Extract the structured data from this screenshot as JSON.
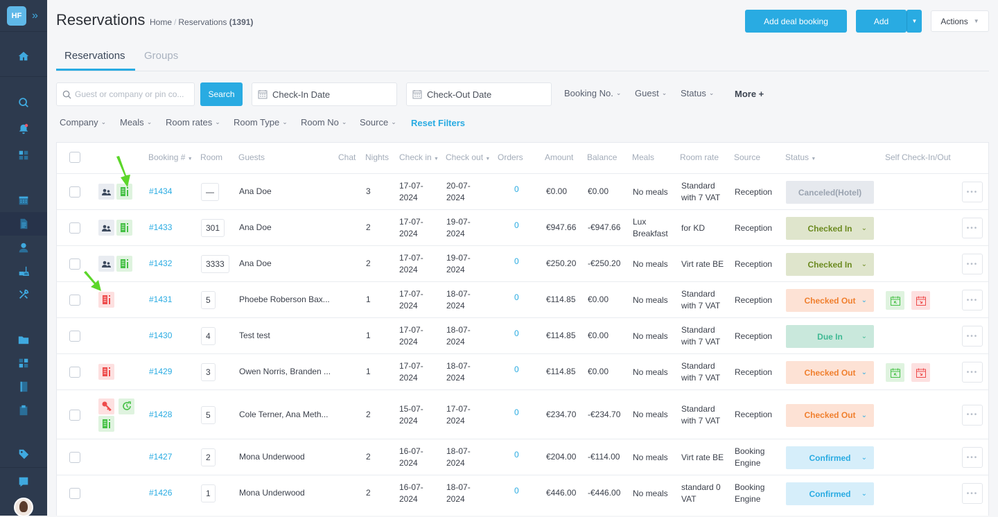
{
  "app": {
    "logo_text": "HF"
  },
  "header": {
    "title": "Reservations",
    "breadcrumb": {
      "home": "Home",
      "current": "Reservations",
      "count": "(1391)"
    },
    "add_deal_label": "Add deal booking",
    "add_label": "Add",
    "actions_label": "Actions"
  },
  "tabs": [
    {
      "label": "Reservations",
      "active": true
    },
    {
      "label": "Groups",
      "active": false
    }
  ],
  "filters": {
    "search_placeholder": "Guest or company or pin co...",
    "search_button": "Search",
    "checkin_placeholder": "Check-In Date",
    "checkout_placeholder": "Check-Out Date",
    "row1": [
      "Booking No.",
      "Guest",
      "Status"
    ],
    "more": "More +",
    "row2": [
      "Company",
      "Meals",
      "Room rates",
      "Room Type",
      "Room No",
      "Source"
    ],
    "reset": "Reset Filters"
  },
  "columns": {
    "booking": "Booking #",
    "room": "Room",
    "guests": "Guests",
    "chat": "Chat",
    "nights": "Nights",
    "checkin": "Check in",
    "checkout": "Check out",
    "orders": "Orders",
    "amount": "Amount",
    "balance": "Balance",
    "meals": "Meals",
    "rate": "Room rate",
    "source": "Source",
    "status": "Status",
    "self": "Self Check-In/Out"
  },
  "rows": [
    {
      "icons": [
        "group-grey",
        "invoice-green"
      ],
      "booking": "#1434",
      "room": "—",
      "guests": "Ana Doe",
      "nights": "3",
      "checkin": [
        "17-07-",
        "2024"
      ],
      "checkout": [
        "20-07-",
        "2024"
      ],
      "orders": "0",
      "amount": "€0.00",
      "balance": "€0.00",
      "meals": [
        "No meals"
      ],
      "rate": [
        "Standard",
        "with 7 VAT"
      ],
      "source": [
        "Reception"
      ],
      "status": "Canceled(Hotel)",
      "status_type": "canceled",
      "self": false
    },
    {
      "icons": [
        "group-grey",
        "invoice-green"
      ],
      "booking": "#1433",
      "room": "301",
      "guests": "Ana Doe",
      "nights": "2",
      "checkin": [
        "17-07-",
        "2024"
      ],
      "checkout": [
        "19-07-",
        "2024"
      ],
      "orders": "0",
      "amount": "€947.66",
      "balance": "-€947.66",
      "meals": [
        "Lux",
        "Breakfast"
      ],
      "rate": [
        "for KD"
      ],
      "source": [
        "Reception"
      ],
      "status": "Checked In",
      "status_type": "checkedin",
      "self": false
    },
    {
      "icons": [
        "group-grey",
        "invoice-green"
      ],
      "booking": "#1432",
      "room": "3333",
      "guests": "Ana Doe",
      "nights": "2",
      "checkin": [
        "17-07-",
        "2024"
      ],
      "checkout": [
        "19-07-",
        "2024"
      ],
      "orders": "0",
      "amount": "€250.20",
      "balance": "-€250.20",
      "meals": [
        "No meals"
      ],
      "rate": [
        "Virt rate BE"
      ],
      "source": [
        "Reception"
      ],
      "status": "Checked In",
      "status_type": "checkedin",
      "self": false
    },
    {
      "icons": [
        "invoice-red"
      ],
      "booking": "#1431",
      "room": "5",
      "guests": "Phoebe Roberson Bax...",
      "nights": "1",
      "checkin": [
        "17-07-",
        "2024"
      ],
      "checkout": [
        "18-07-",
        "2024"
      ],
      "orders": "0",
      "amount": "€114.85",
      "balance": "€0.00",
      "meals": [
        "No meals"
      ],
      "rate": [
        "Standard",
        "with 7 VAT"
      ],
      "source": [
        "Reception"
      ],
      "status": "Checked Out",
      "status_type": "checkedout",
      "self": true
    },
    {
      "icons": [],
      "booking": "#1430",
      "room": "4",
      "guests": "Test test",
      "nights": "1",
      "checkin": [
        "17-07-",
        "2024"
      ],
      "checkout": [
        "18-07-",
        "2024"
      ],
      "orders": "0",
      "amount": "€114.85",
      "balance": "€0.00",
      "meals": [
        "No meals"
      ],
      "rate": [
        "Standard",
        "with 7 VAT"
      ],
      "source": [
        "Reception"
      ],
      "status": "Due In",
      "status_type": "duein",
      "self": false
    },
    {
      "icons": [
        "invoice-red"
      ],
      "booking": "#1429",
      "room": "3",
      "guests": "Owen Norris, Branden ...",
      "nights": "1",
      "checkin": [
        "17-07-",
        "2024"
      ],
      "checkout": [
        "18-07-",
        "2024"
      ],
      "orders": "0",
      "amount": "€114.85",
      "balance": "€0.00",
      "meals": [
        "No meals"
      ],
      "rate": [
        "Standard",
        "with 7 VAT"
      ],
      "source": [
        "Reception"
      ],
      "status": "Checked Out",
      "status_type": "checkedout",
      "self": true
    },
    {
      "icons": [
        "key-red",
        "refresh-green",
        "invoice-green"
      ],
      "booking": "#1428",
      "room": "5",
      "guests": "Cole Terner, Ana Meth...",
      "nights": "2",
      "checkin": [
        "15-07-",
        "2024"
      ],
      "checkout": [
        "17-07-",
        "2024"
      ],
      "orders": "0",
      "amount": "€234.70",
      "balance": "-€234.70",
      "meals": [
        "No meals"
      ],
      "rate": [
        "Standard",
        "with 7 VAT"
      ],
      "source": [
        "Reception"
      ],
      "status": "Checked Out",
      "status_type": "checkedout",
      "self": false
    },
    {
      "icons": [],
      "booking": "#1427",
      "room": "2",
      "guests": "Mona Underwood",
      "nights": "2",
      "checkin": [
        "16-07-",
        "2024"
      ],
      "checkout": [
        "18-07-",
        "2024"
      ],
      "orders": "0",
      "amount": "€204.00",
      "balance": "-€114.00",
      "meals": [
        "No meals"
      ],
      "rate": [
        "Virt rate BE"
      ],
      "source": [
        "Booking",
        "Engine"
      ],
      "status": "Confirmed",
      "status_type": "confirmed",
      "self": false
    },
    {
      "icons": [],
      "booking": "#1426",
      "room": "1",
      "guests": "Mona Underwood",
      "nights": "2",
      "checkin": [
        "16-07-",
        "2024"
      ],
      "checkout": [
        "18-07-",
        "2024"
      ],
      "orders": "0",
      "amount": "€446.00",
      "balance": "-€446.00",
      "meals": [
        "No meals"
      ],
      "rate": [
        "standard 0",
        "VAT"
      ],
      "source": [
        "Booking",
        "Engine"
      ],
      "status": "Confirmed",
      "status_type": "confirmed",
      "self": false
    }
  ],
  "colors": {
    "accent": "#29abe2",
    "sidebar": "#2d3a4e",
    "annotation_arrow": "#5cd62a"
  }
}
